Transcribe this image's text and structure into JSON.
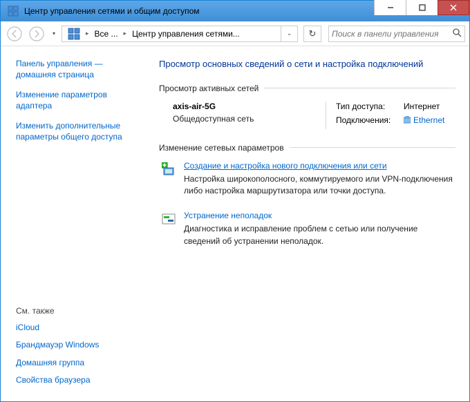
{
  "window": {
    "title": "Центр управления сетями и общим доступом"
  },
  "breadcrumb": {
    "seg1": "Все ...",
    "seg2": "Центр управления сетями..."
  },
  "search": {
    "placeholder": "Поиск в панели управления"
  },
  "sidebar": {
    "cp_home": "Панель управления — домашняя страница",
    "adapter": "Изменение параметров адаптера",
    "sharing": "Изменить дополнительные параметры общего доступа",
    "see_also": "См. также",
    "items": {
      "icloud": "iCloud",
      "firewall": "Брандмауэр Windows",
      "homegroup": "Домашняя группа",
      "browser": "Свойства браузера"
    }
  },
  "main": {
    "heading": "Просмотр основных сведений о сети и настройка подключений",
    "active_nets": "Просмотр активных сетей",
    "net": {
      "name": "axis-air-5G",
      "type": "Общедоступная сеть",
      "access_label": "Тип доступа:",
      "access_value": "Интернет",
      "conn_label": "Подключения:",
      "conn_value": "Ethernet"
    },
    "change_settings": "Изменение сетевых параметров",
    "new_conn": {
      "title": "Создание и настройка нового подключения или сети",
      "desc": "Настройка широкополосного, коммутируемого или VPN-подключения либо настройка маршрутизатора или точки доступа."
    },
    "troubleshoot": {
      "title": "Устранение неполадок",
      "desc": "Диагностика и исправление проблем с сетью или получение сведений об устранении неполадок."
    }
  }
}
